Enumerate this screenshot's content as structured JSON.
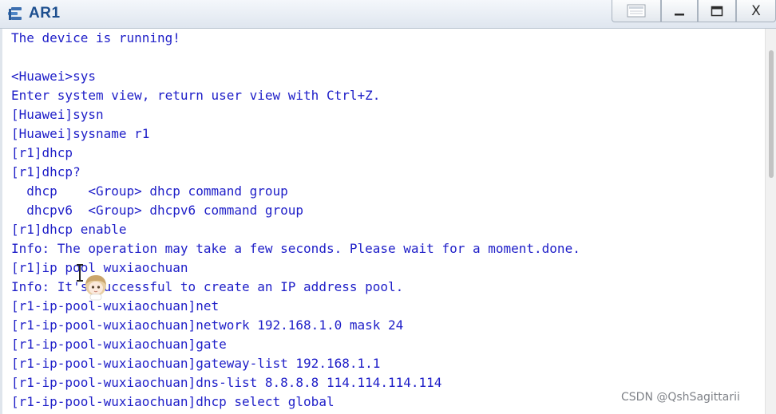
{
  "window": {
    "title": "AR1",
    "icon": "router-terminal-icon",
    "controls": {
      "restore_icon": "restore-icon",
      "minimize_icon": "minimize-icon",
      "maximize_icon": "maximize-icon",
      "close_label": "X"
    }
  },
  "console": {
    "text_color": "#1e1ec8",
    "lines": [
      "The device is running!",
      "",
      "<Huawei>sys",
      "Enter system view, return user view with Ctrl+Z.",
      "[Huawei]sysn",
      "[Huawei]sysname r1",
      "[r1]dhcp",
      "[r1]dhcp?",
      "  dhcp    <Group> dhcp command group",
      "  dhcpv6  <Group> dhcpv6 command group",
      "[r1]dhcp enable",
      "Info: The operation may take a few seconds. Please wait for a moment.done.",
      "[r1]ip pool wuxiaochuan",
      "Info: It's successful to create an IP address pool.",
      "[r1-ip-pool-wuxiaochuan]net",
      "[r1-ip-pool-wuxiaochuan]network 192.168.1.0 mask 24",
      "[r1-ip-pool-wuxiaochuan]gate",
      "[r1-ip-pool-wuxiaochuan]gateway-list 192.168.1.1",
      "[r1-ip-pool-wuxiaochuan]dns-list 8.8.8.8 114.114.114.114",
      "[r1-ip-pool-wuxiaochuan]dhcp select global"
    ]
  },
  "overlay": {
    "text_cursor_icon": "text-ibeam-cursor-icon",
    "sticker_icon": "anime-avatar-sticker"
  },
  "watermark": "CSDN @QshSagittarii"
}
